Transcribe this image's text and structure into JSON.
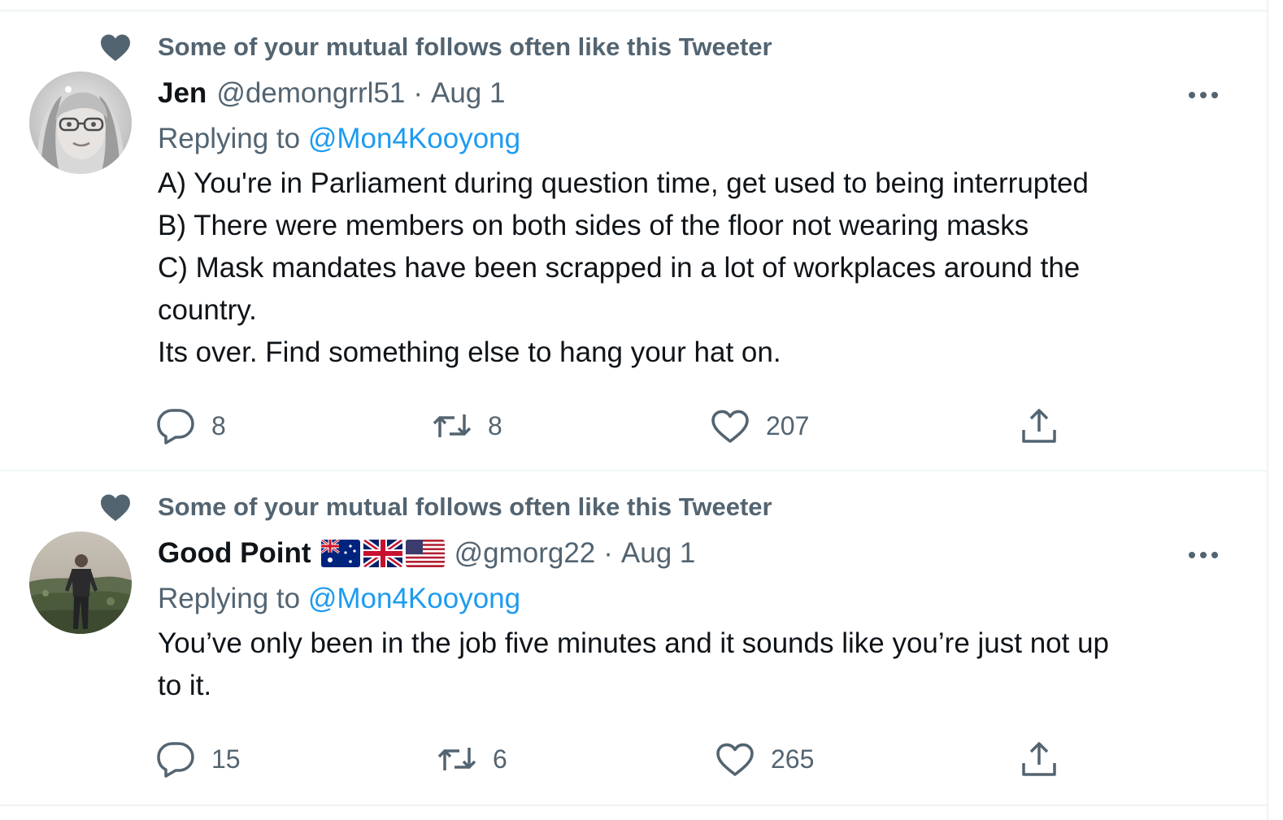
{
  "colors": {
    "text_primary": "#0f1419",
    "text_secondary": "#536471",
    "link": "#1d9bf0",
    "border": "#eff3f4"
  },
  "tweets": [
    {
      "social_context": "Some of your mutual follows often like this Tweeter",
      "author_name": "Jen",
      "handle": "@demongrrl51",
      "separator": "·",
      "date": "Aug 1",
      "replying_prefix": "Replying to",
      "replying_to": "@Mon4Kooyong",
      "lines": [
        "A) You're in Parliament during question time, get used to being interrupted",
        "B) There were members on both sides of the floor not wearing masks",
        "C) Mask mandates have been scrapped in a lot of workplaces around the",
        "country.",
        "Its over. Find something else to hang your hat on."
      ],
      "replies": "8",
      "retweets": "8",
      "likes": "207",
      "icons": {
        "social": "heart-icon",
        "more": "more-icon",
        "reply": "reply-icon",
        "retweet": "retweet-icon",
        "like": "like-icon",
        "share": "share-icon"
      }
    },
    {
      "social_context": "Some of your mutual follows often like this Tweeter",
      "author_name": "Good Point",
      "flags": [
        "australia-flag",
        "uk-flag",
        "usa-flag"
      ],
      "handle": "@gmorg22",
      "separator": "·",
      "date": "Aug 1",
      "replying_prefix": "Replying to",
      "replying_to": "@Mon4Kooyong",
      "lines": [
        "You’ve only been in the job five minutes and it sounds like you’re just not up",
        "to it."
      ],
      "replies": "15",
      "retweets": "6",
      "likes": "265",
      "icons": {
        "social": "heart-icon",
        "more": "more-icon",
        "reply": "reply-icon",
        "retweet": "retweet-icon",
        "like": "like-icon",
        "share": "share-icon"
      }
    }
  ]
}
